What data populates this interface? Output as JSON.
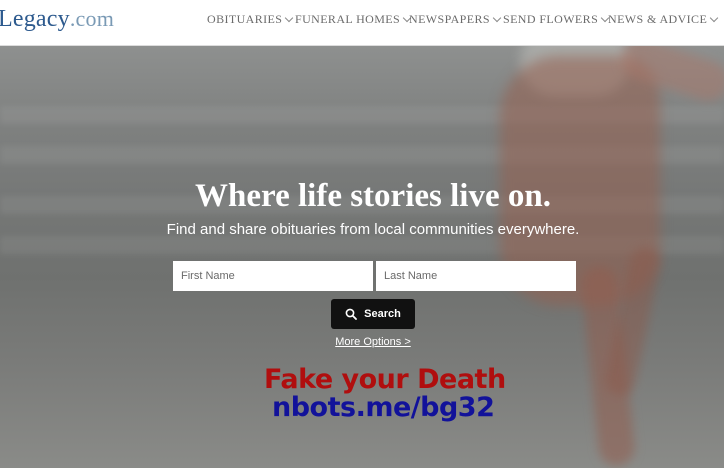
{
  "header": {
    "logo": {
      "word": "Legacy",
      "suffix": ".com"
    },
    "nav": [
      {
        "label": "OBITUARIES"
      },
      {
        "label": "FUNERAL HOMES"
      },
      {
        "label": "NEWSPAPERS"
      },
      {
        "label": "SEND FLOWERS"
      },
      {
        "label": "NEWS & ADVICE"
      }
    ]
  },
  "hero": {
    "headline": "Where life stories live on.",
    "subline": "Find and share obituaries from local communities everywhere.",
    "first_name_placeholder": "First Name",
    "last_name_placeholder": "Last Name",
    "search_label": "Search",
    "more_options": "More Options >"
  },
  "overlay": {
    "line1": "Fake your Death",
    "line2": "nbots.me/bg32",
    "line1_color": "#b00e0e",
    "line2_color": "#12129a"
  },
  "icons": {
    "search": "search-icon",
    "dropdown": "chevron-down-icon"
  },
  "colors": {
    "brand": "#2d5a8e",
    "button": "#111111"
  }
}
